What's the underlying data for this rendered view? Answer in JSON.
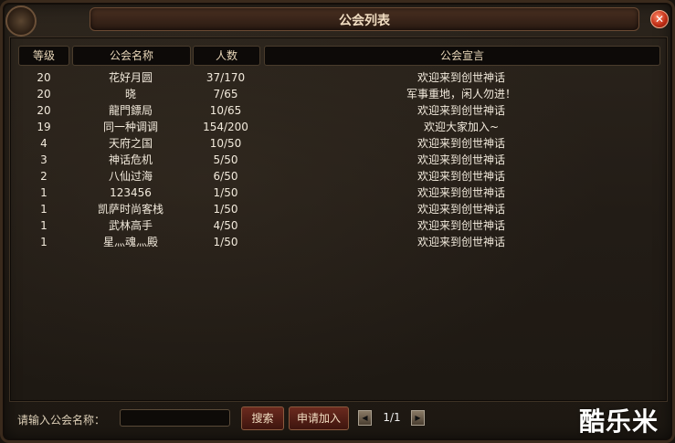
{
  "window": {
    "title": "公会列表"
  },
  "table": {
    "headers": {
      "level": "等级",
      "name": "公会名称",
      "members": "人数",
      "declaration": "公会宣言"
    },
    "rows": [
      {
        "level": "20",
        "name": "花好月圆",
        "members": "37/170",
        "declaration": "欢迎来到创世神话"
      },
      {
        "level": "20",
        "name": "晓",
        "members": "7/65",
        "declaration": "军事重地，闲人勿进！"
      },
      {
        "level": "20",
        "name": "龍門鏢局",
        "members": "10/65",
        "declaration": "欢迎来到创世神话"
      },
      {
        "level": "19",
        "name": "同一种调调",
        "members": "154/200",
        "declaration": "欢迎大家加入~"
      },
      {
        "level": "4",
        "name": "天府之国",
        "members": "10/50",
        "declaration": "欢迎来到创世神话"
      },
      {
        "level": "3",
        "name": "神话危机",
        "members": "5/50",
        "declaration": "欢迎来到创世神话"
      },
      {
        "level": "2",
        "name": "八仙过海",
        "members": "6/50",
        "declaration": "欢迎来到创世神话"
      },
      {
        "level": "1",
        "name": "123456",
        "members": "1/50",
        "declaration": "欢迎来到创世神话"
      },
      {
        "level": "1",
        "name": "凯萨时尚客栈",
        "members": "1/50",
        "declaration": "欢迎来到创世神话"
      },
      {
        "level": "1",
        "name": "武林高手",
        "members": "4/50",
        "declaration": "欢迎来到创世神话"
      },
      {
        "level": "1",
        "name": "星灬魂灬殿",
        "members": "1/50",
        "declaration": "欢迎来到创世神话"
      }
    ]
  },
  "search": {
    "label": "请输入公会名称：",
    "value": "",
    "search_button": "搜索",
    "apply_button": "申请加入"
  },
  "pagination": {
    "current": "1/1"
  },
  "watermark": "酷乐米",
  "icons": {
    "close": "close-icon",
    "prev": "prev-page-icon",
    "next": "next-page-icon"
  }
}
